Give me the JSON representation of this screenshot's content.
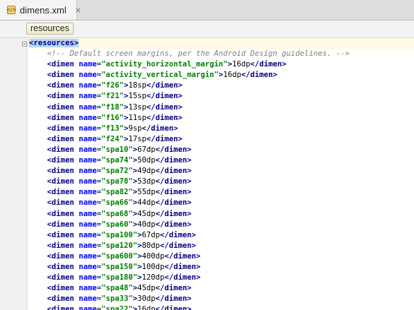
{
  "tab": {
    "label": "dimens.xml",
    "icon": "xml-file-icon",
    "close": "×"
  },
  "breadcrumb": {
    "label": "resources"
  },
  "code": {
    "root_open": "<resources>",
    "comment": "<!-- Default screen margins, per the Android Design guidelines. -->",
    "dimens": [
      {
        "name": "\"activity_horizontal_margin\"",
        "value": "16dp"
      },
      {
        "name": "\"activity_vertical_margin\"",
        "value": "16dp"
      },
      {
        "name": "\"f26\"",
        "value": "18sp"
      },
      {
        "name": "\"f21\"",
        "value": "15sp"
      },
      {
        "name": "\"f18\"",
        "value": "13sp"
      },
      {
        "name": "\"f16\"",
        "value": "11sp"
      },
      {
        "name": "\"f13\"",
        "value": "9sp"
      },
      {
        "name": "\"f24\"",
        "value": "17sp"
      },
      {
        "name": "\"spa10\"",
        "value": "67dp"
      },
      {
        "name": "\"spa74\"",
        "value": "50dp"
      },
      {
        "name": "\"spa72\"",
        "value": "49dp"
      },
      {
        "name": "\"spa78\"",
        "value": "53dp"
      },
      {
        "name": "\"spa82\"",
        "value": "55dp"
      },
      {
        "name": "\"spa66\"",
        "value": "44dp"
      },
      {
        "name": "\"spa68\"",
        "value": "45dp"
      },
      {
        "name": "\"spa60\"",
        "value": "40dp"
      },
      {
        "name": "\"spa100\"",
        "value": "67dp"
      },
      {
        "name": "\"spa120\"",
        "value": "80dp"
      },
      {
        "name": "\"spa600\"",
        "value": "400dp"
      },
      {
        "name": "\"spa150\"",
        "value": "100dp"
      },
      {
        "name": "\"spa180\"",
        "value": "120dp"
      },
      {
        "name": "\"spa48\"",
        "value": "45dp"
      },
      {
        "name": "\"spa33\"",
        "value": "30dp"
      },
      {
        "name": "\"spa22\"",
        "value": "16dp"
      }
    ],
    "tokens": {
      "open_tag": "<dimen",
      "attr": "name",
      "eq": "=",
      "gt": ">",
      "close_tag": "</dimen>"
    }
  },
  "colors": {
    "tag": "#000080",
    "attribute": "#0000ff",
    "value": "#008000",
    "comment": "#808080",
    "selection": "#b7d6fb",
    "caret_line": "#fffae3"
  }
}
